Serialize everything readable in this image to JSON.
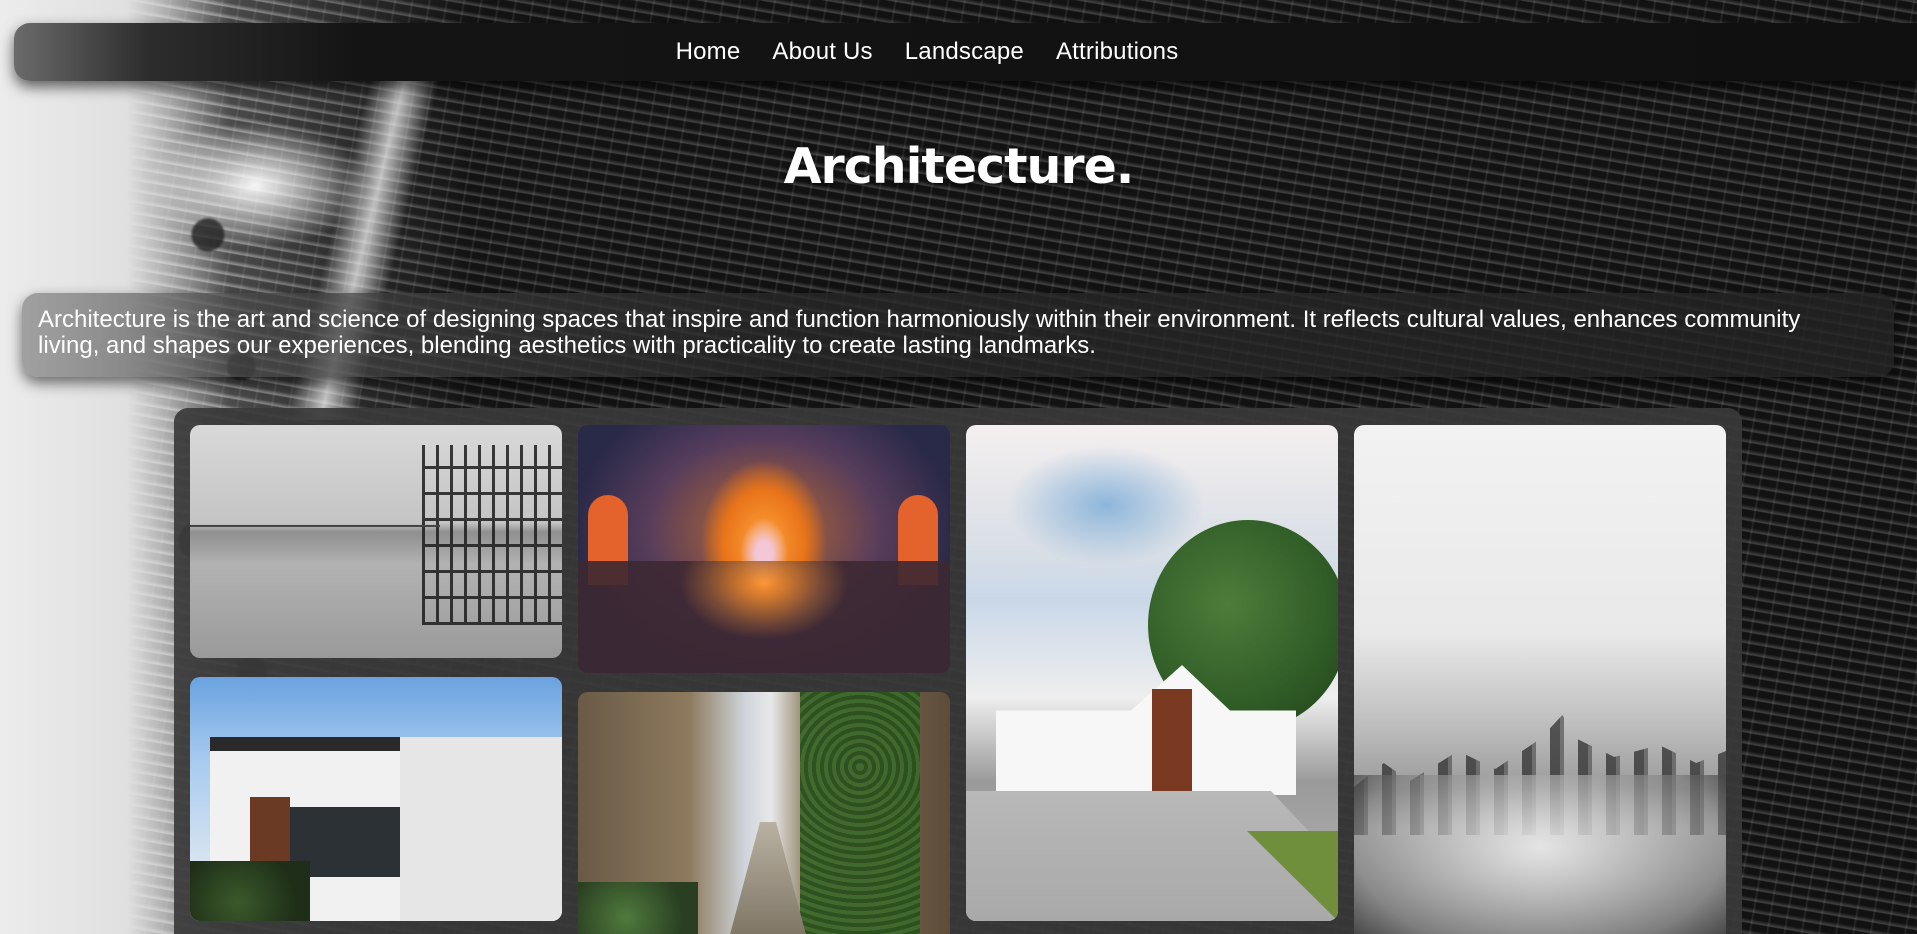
{
  "nav": {
    "items": [
      {
        "label": "Home"
      },
      {
        "label": "About Us"
      },
      {
        "label": "Landscape"
      },
      {
        "label": "Attributions"
      }
    ]
  },
  "hero": {
    "title": "Architecture."
  },
  "intro": {
    "text": "Architecture is the art and science of designing spaces that inspire and function harmoniously within their environment. It reflects cultural values, enhances community living, and shapes our experiences, blending aesthetics with practicality to create lasting landmarks."
  },
  "gallery": {
    "images": [
      {
        "name": "monochrome-reflective-pavilion"
      },
      {
        "name": "orange-arched-tunnel"
      },
      {
        "name": "white-house-with-tree"
      },
      {
        "name": "skyline-above-clouds"
      },
      {
        "name": "modern-white-residence"
      },
      {
        "name": "ivy-covered-stone-alley"
      }
    ]
  },
  "colors": {
    "nav_background": "#101010",
    "text": "#ffffff",
    "gallery_background": "#3a3a3a"
  }
}
